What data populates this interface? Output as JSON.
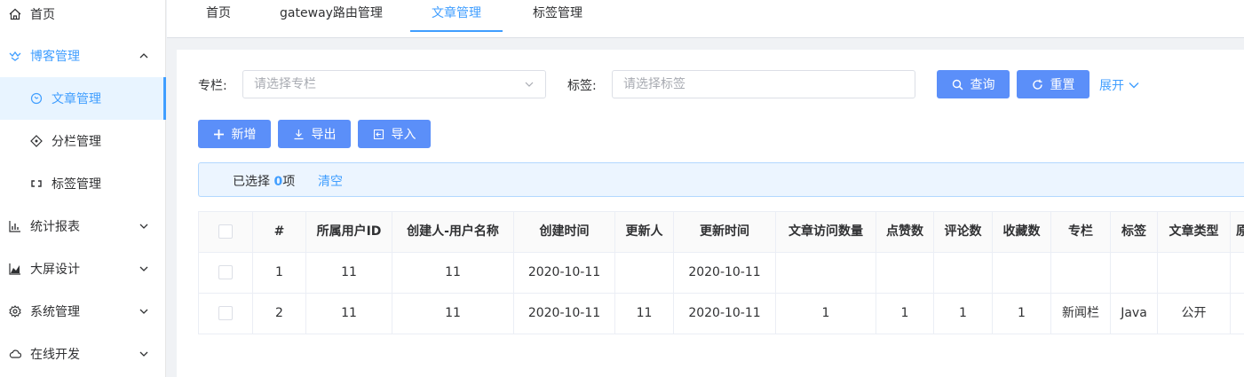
{
  "sidebar": {
    "items": [
      {
        "label": "首页",
        "icon": "home-icon"
      },
      {
        "label": "博客管理",
        "icon": "blog-icon"
      },
      {
        "label": "文章管理",
        "icon": "article-icon"
      },
      {
        "label": "分栏管理",
        "icon": "column-icon"
      },
      {
        "label": "标签管理",
        "icon": "tag-icon"
      },
      {
        "label": "统计报表",
        "icon": "stats-icon"
      },
      {
        "label": "大屏设计",
        "icon": "screen-icon"
      },
      {
        "label": "系统管理",
        "icon": "gear-icon"
      },
      {
        "label": "在线开发",
        "icon": "cloud-icon"
      }
    ]
  },
  "tabs": [
    "首页",
    "gateway路由管理",
    "文章管理",
    "标签管理"
  ],
  "search": {
    "column_label": "专栏:",
    "column_placeholder": "请选择专栏",
    "tag_label": "标签:",
    "tag_placeholder": "请选择标签",
    "query_button": "查询",
    "reset_button": "重置",
    "expand_button": "展开"
  },
  "toolbar": {
    "add_button": "新增",
    "export_button": "导出",
    "import_button": "导入"
  },
  "selection": {
    "prefix": "已选择 ",
    "count": "0",
    "suffix": "项",
    "clear": "清空"
  },
  "table": {
    "headers": [
      "",
      "#",
      "所属用户ID",
      "创建人-用户名称",
      "创建时间",
      "更新人",
      "更新时间",
      "文章访问数量",
      "点赞数",
      "评论数",
      "收藏数",
      "专栏",
      "标签",
      "文章类型",
      "原"
    ],
    "rows": [
      [
        "",
        "1",
        "11",
        "11",
        "2020-10-11",
        "",
        "2020-10-11",
        "",
        "",
        "",
        "",
        "",
        "",
        "",
        ""
      ],
      [
        "",
        "2",
        "11",
        "11",
        "2020-10-11",
        "11",
        "2020-10-11",
        "1",
        "1",
        "1",
        "1",
        "新闻栏",
        "Java",
        "公开",
        ""
      ]
    ]
  },
  "colors": {
    "primary": "#409eff",
    "button": "#5b8ff9",
    "active_bg": "#e8f4ff"
  }
}
